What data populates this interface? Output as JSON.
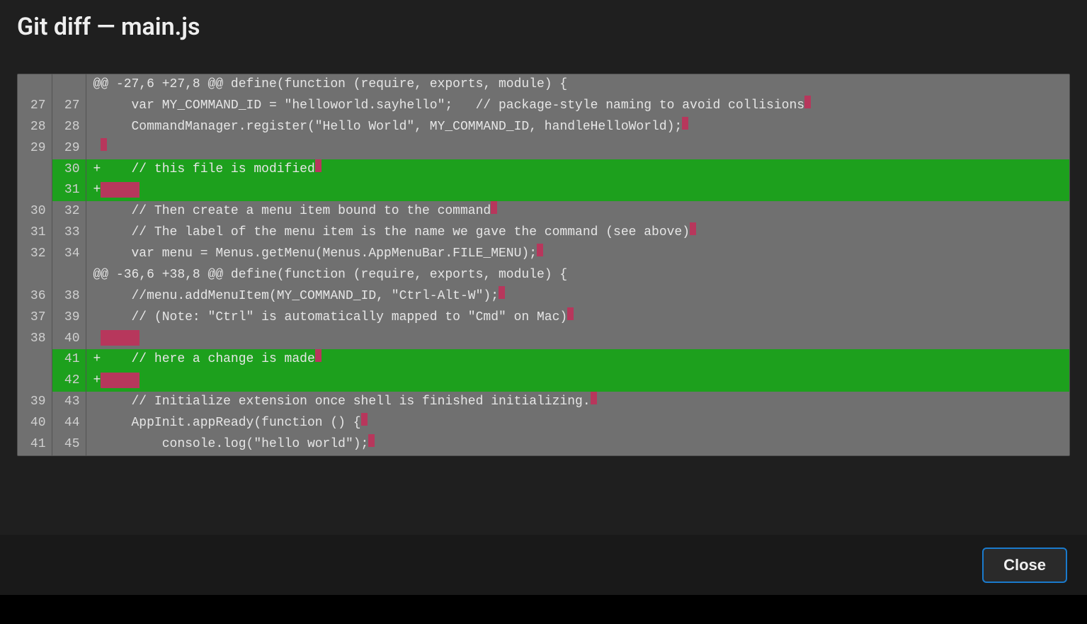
{
  "title": "Git diff — main.js",
  "close_label": "Close",
  "diff": {
    "lines": [
      {
        "type": "hunk",
        "old": "",
        "new": "",
        "prefix": "",
        "text": "@@ -27,6 +27,8 @@ define(function (require, exports, module) {",
        "trail": "none"
      },
      {
        "type": "context",
        "old": "27",
        "new": "27",
        "prefix": " ",
        "text": "    var MY_COMMAND_ID = \"helloworld.sayhello\";   // package-style naming to avoid collisions",
        "trail": "single"
      },
      {
        "type": "context",
        "old": "28",
        "new": "28",
        "prefix": " ",
        "text": "    CommandManager.register(\"Hello World\", MY_COMMAND_ID, handleHelloWorld);",
        "trail": "single"
      },
      {
        "type": "context",
        "old": "29",
        "new": "29",
        "prefix": " ",
        "text": "",
        "trail": "single"
      },
      {
        "type": "add",
        "old": "",
        "new": "30",
        "prefix": "+",
        "text": "    // this file is modified",
        "trail": "single"
      },
      {
        "type": "add",
        "old": "",
        "new": "31",
        "prefix": "+",
        "text": "",
        "trail": "block"
      },
      {
        "type": "context",
        "old": "30",
        "new": "32",
        "prefix": " ",
        "text": "    // Then create a menu item bound to the command",
        "trail": "single"
      },
      {
        "type": "context",
        "old": "31",
        "new": "33",
        "prefix": " ",
        "text": "    // The label of the menu item is the name we gave the command (see above)",
        "trail": "single"
      },
      {
        "type": "context",
        "old": "32",
        "new": "34",
        "prefix": " ",
        "text": "    var menu = Menus.getMenu(Menus.AppMenuBar.FILE_MENU);",
        "trail": "single"
      },
      {
        "type": "hunk",
        "old": "",
        "new": "",
        "prefix": "",
        "text": "@@ -36,6 +38,8 @@ define(function (require, exports, module) {",
        "trail": "none"
      },
      {
        "type": "context",
        "old": "36",
        "new": "38",
        "prefix": " ",
        "text": "    //menu.addMenuItem(MY_COMMAND_ID, \"Ctrl-Alt-W\");",
        "trail": "single"
      },
      {
        "type": "context",
        "old": "37",
        "new": "39",
        "prefix": " ",
        "text": "    // (Note: \"Ctrl\" is automatically mapped to \"Cmd\" on Mac)",
        "trail": "single"
      },
      {
        "type": "context",
        "old": "38",
        "new": "40",
        "prefix": " ",
        "text": "",
        "trail": "block"
      },
      {
        "type": "add",
        "old": "",
        "new": "41",
        "prefix": "+",
        "text": "    // here a change is made",
        "trail": "single"
      },
      {
        "type": "add",
        "old": "",
        "new": "42",
        "prefix": "+",
        "text": "",
        "trail": "block"
      },
      {
        "type": "context",
        "old": "39",
        "new": "43",
        "prefix": " ",
        "text": "    // Initialize extension once shell is finished initializing.",
        "trail": "single"
      },
      {
        "type": "context",
        "old": "40",
        "new": "44",
        "prefix": " ",
        "text": "    AppInit.appReady(function () {",
        "trail": "single"
      },
      {
        "type": "context",
        "old": "41",
        "new": "45",
        "prefix": " ",
        "text": "        console.log(\"hello world\");",
        "trail": "single"
      }
    ]
  }
}
